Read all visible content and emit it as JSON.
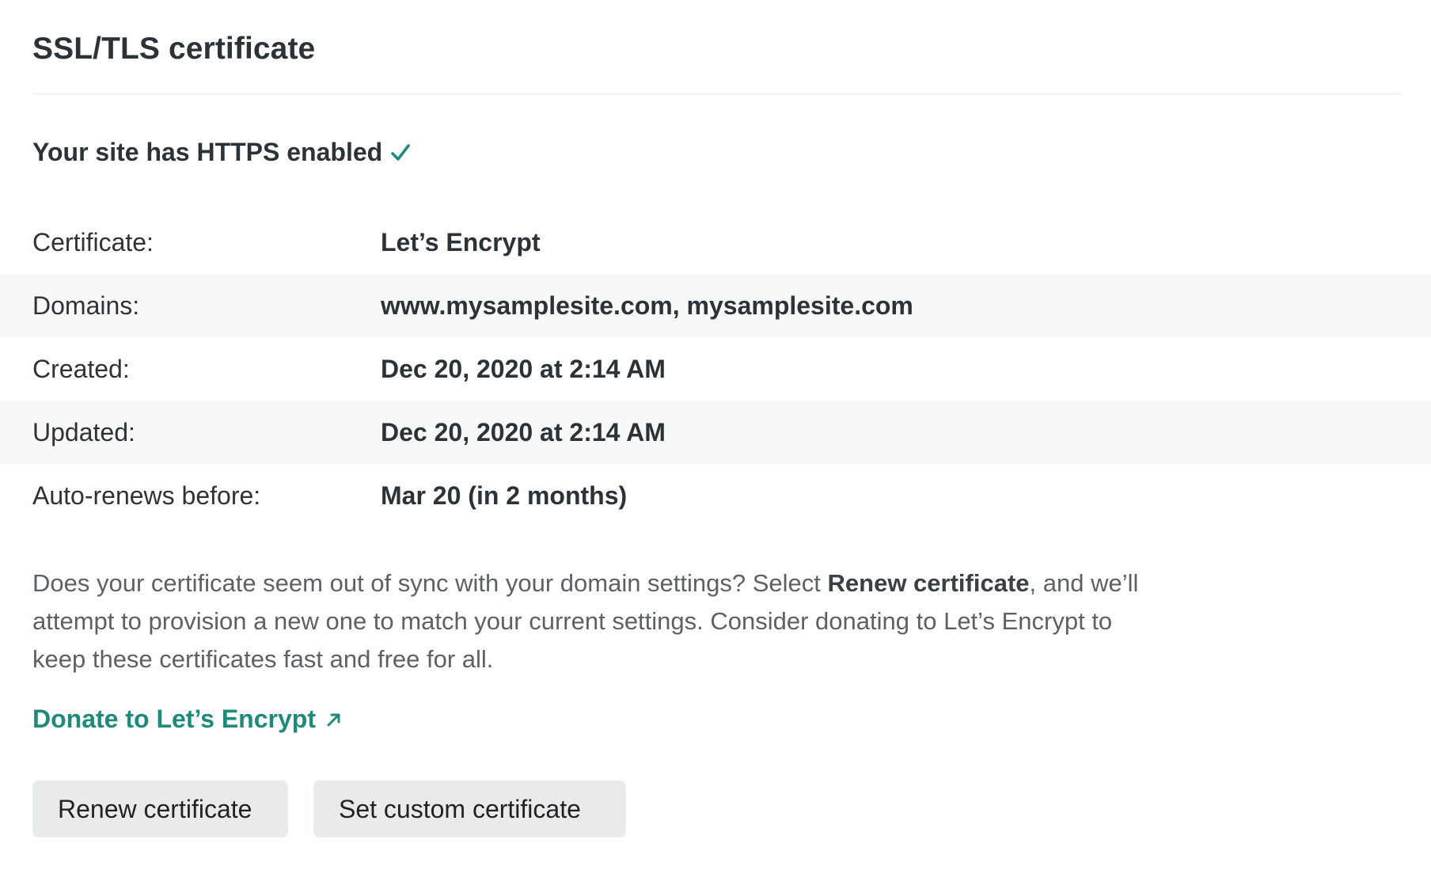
{
  "section": {
    "title": "SSL/TLS certificate"
  },
  "status": {
    "text": "Your site has HTTPS enabled",
    "icon": "checkmark-icon",
    "icon_color": "#1f8a7a"
  },
  "details": [
    {
      "label": "Certificate:",
      "value": "Let’s Encrypt"
    },
    {
      "label": "Domains:",
      "value": "www.mysamplesite.com, mysamplesite.com"
    },
    {
      "label": "Created:",
      "value": "Dec 20, 2020 at 2:14 AM"
    },
    {
      "label": "Updated:",
      "value": "Dec 20, 2020 at 2:14 AM"
    },
    {
      "label": "Auto-renews before:",
      "value": "Mar 20 (in 2 months)"
    }
  ],
  "description": {
    "part1": "Does your certificate seem out of sync with your domain settings? Select ",
    "bold": "Renew certificate",
    "part2": ", and we’ll attempt to provision a new one to match your current settings. Consider donating to Let’s Encrypt to keep these certificates fast and free for all."
  },
  "donate_link": {
    "label": "Donate to Let’s Encrypt",
    "icon": "external-arrow-icon"
  },
  "buttons": {
    "renew": "Renew certificate",
    "custom": "Set custom certificate"
  },
  "colors": {
    "accent": "#1f8a7a",
    "row_alt_bg": "#f7f8f8",
    "button_bg": "#e9ebeb"
  }
}
